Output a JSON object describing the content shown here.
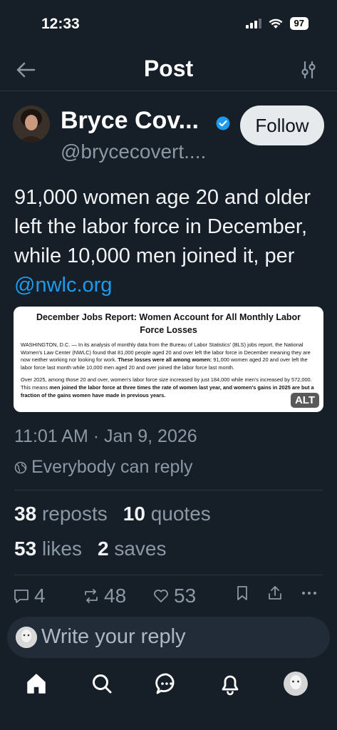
{
  "status_bar": {
    "time": "12:33",
    "battery": "97"
  },
  "header": {
    "title": "Post"
  },
  "author": {
    "display_name": "Bryce Cov...",
    "handle": "@brycecovert....",
    "follow_label": "Follow"
  },
  "post": {
    "text_before_mention": "91,000 women age 20 and older left the labor force in December, while 10,000 men joined it, per ",
    "mention": "@nwlc.org",
    "embed": {
      "title": "December Jobs Report: Women Account for All Monthly Labor Force Losses",
      "p1_plain": "WASHINGTON, D.C. — In its analysis of monthly data from the Bureau of Labor Statistics' (BLS) jobs report, the National Women's Law Center (NWLC) found that 81,000 people aged 20 and over left the labor force in December meaning they are now neither working nor looking for work. ",
      "p1_bold": "These losses were all among women:",
      "p1_tail": " 91,000 women aged 20 and over left the labor force last month while 10,000 men aged 20 and over joined the labor force last month.",
      "p2_plain": "Over 2025, among those 20 and over, women's labor force size increased by just 184,000 while men's increased by 572,000. This means ",
      "p2_bold": "men joined the labor force at three times the rate of women last year, and women's gains in 2025 are but a fraction of the gains women have made in previous years.",
      "alt_label": "ALT"
    },
    "timestamp": "11:01 AM · Jan 9, 2026",
    "reply_setting": "Everybody can reply"
  },
  "stats": {
    "reposts_count": "38",
    "reposts_label": "reposts",
    "quotes_count": "10",
    "quotes_label": "quotes",
    "likes_count": "53",
    "likes_label": "likes",
    "saves_count": "2",
    "saves_label": "saves"
  },
  "actions": {
    "replies": "4",
    "reposts": "48",
    "likes": "53"
  },
  "reply_bar": {
    "placeholder": "Write your reply"
  },
  "colors": {
    "background": "#161e27",
    "accent": "#1d9bf0",
    "muted": "#8b98a5"
  },
  "tabs": [
    "home-icon",
    "search-icon",
    "chat-icon",
    "bell-icon",
    "profile-avatar"
  ]
}
